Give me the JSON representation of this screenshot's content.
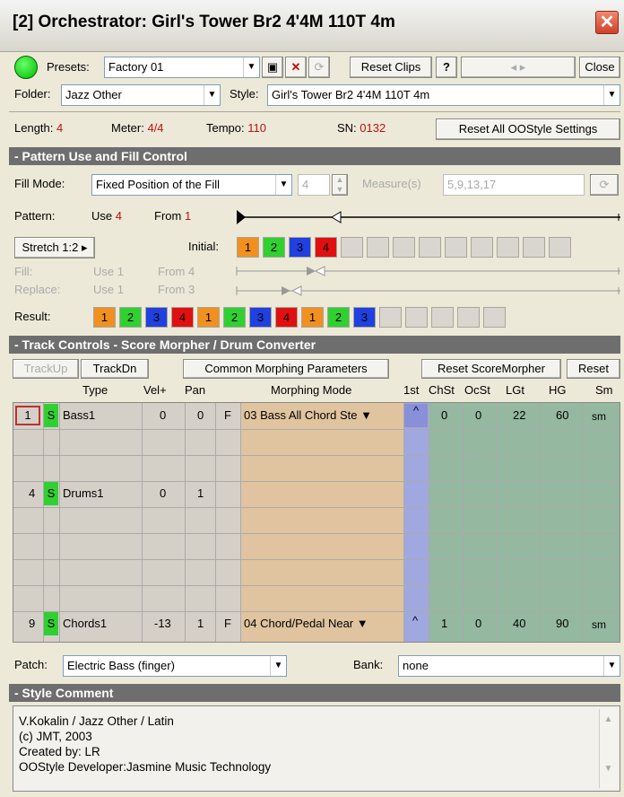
{
  "window": {
    "title": "[2] Orchestrator: Girl's Tower Br2 4'4M 110T 4m",
    "close": "✕"
  },
  "toolbar": {
    "presets_label": "Presets:",
    "presets_value": "Factory 01",
    "reset_clips": "Reset Clips",
    "help": "?",
    "close": "Close",
    "save_icon": "▣",
    "delete_icon": "✕",
    "refresh_icon": "⟳"
  },
  "folder": {
    "label": "Folder:",
    "value": "Jazz Other",
    "style_label": "Style:",
    "style_value": "Girl's Tower Br2 4'4M 110T 4m"
  },
  "info": {
    "length_label": "Length:",
    "length": "4",
    "meter_label": "Meter:",
    "meter": "4/4",
    "tempo_label": "Tempo:",
    "tempo": "110",
    "sn_label": "SN:",
    "sn": "0132",
    "reset_all": "Reset All OOStyle Settings"
  },
  "pattern_section": {
    "header": "- Pattern Use and Fill Control",
    "fill_mode_label": "Fill Mode:",
    "fill_mode": "Fixed Position of the Fill",
    "spin_value": "4",
    "measures_label": "Measure(s)",
    "measures": "5,9,13,17",
    "pattern_label": "Pattern:",
    "use_label": "Use",
    "use_val": "4",
    "from_label": "From",
    "from_val": "1",
    "stretch": "Stretch 1:2",
    "initial_label": "Initial:",
    "fill_label": "Fill:",
    "fill_use": "Use 1",
    "fill_from": "From 4",
    "replace_label": "Replace:",
    "replace_use": "Use 1",
    "replace_from": "From 3",
    "result_label": "Result:"
  },
  "initial_cells": [
    "1",
    "2",
    "3",
    "4",
    "",
    "",
    "",
    "",
    "",
    "",
    "",
    "",
    ""
  ],
  "result_cells": [
    "1",
    "2",
    "3",
    "4",
    "1",
    "2",
    "3",
    "4",
    "1",
    "2",
    "3",
    "",
    "",
    "",
    "",
    ""
  ],
  "track_section": {
    "header": "- Track Controls - Score Morpher / Drum Converter",
    "trackup": "TrackUp",
    "trackdn": "TrackDn",
    "common": "Common Morphing Parameters",
    "reset_sm": "Reset ScoreMorpher",
    "reset": "Reset"
  },
  "columns": [
    "Type",
    "Vel+",
    "Pan",
    "Morphing Mode",
    "1st",
    "ChSt",
    "OcSt",
    "LGt",
    "HG",
    "Sm"
  ],
  "tracks": [
    {
      "num": "1",
      "s": "S",
      "type": "Bass1",
      "vel": "0",
      "pan": "0",
      "f": "F",
      "mode": "03 Bass All Chord Ste",
      "first": "^",
      "chst": "0",
      "ocst": "0",
      "lgt": "22",
      "hg": "60",
      "sm": "sm"
    },
    {
      "num": "4",
      "s": "S",
      "type": "Drums1",
      "vel": "0",
      "pan": "1"
    },
    {
      "num": "9",
      "s": "S",
      "type": "Chords1",
      "vel": "-13",
      "pan": "1",
      "f": "F",
      "mode": "04 Chord/Pedal Near",
      "first": "^",
      "chst": "1",
      "ocst": "0",
      "lgt": "40",
      "hg": "90",
      "sm": "sm"
    }
  ],
  "patch": {
    "label": "Patch:",
    "value": "Electric Bass (finger)",
    "bank_label": "Bank:",
    "bank_value": "none"
  },
  "comment": {
    "header": "- Style Comment",
    "lines": [
      "V.Kokalin / Jazz Other / Latin",
      "(c) JMT, 2003",
      "Created by: LR",
      "OOStyle Developer:Jasmine Music Technology"
    ]
  },
  "colors": {
    "c1": "#f09020",
    "c2": "#30d030",
    "c3": "#2040e0",
    "c4": "#e01010",
    "orange_col": "#e0c4a0",
    "blue_col": "#a0a8e0",
    "green_col": "#94b8a0"
  }
}
